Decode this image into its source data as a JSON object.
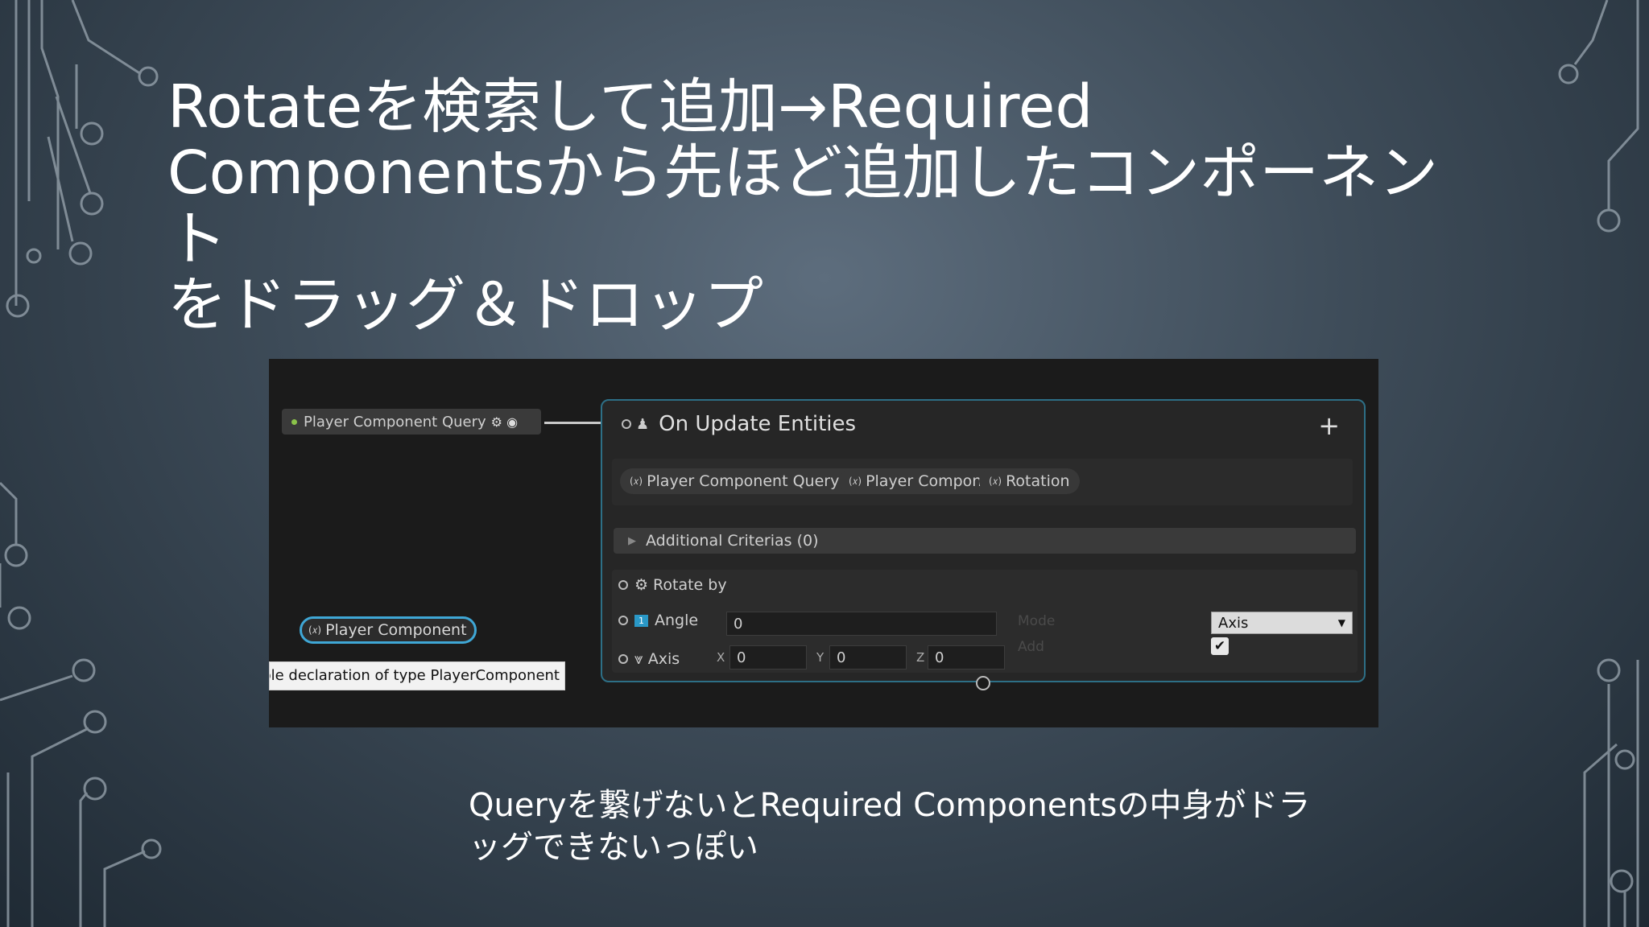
{
  "slide": {
    "title": "Rotateを検索して追加→Required\nComponentsから先ほど追加したコンポーネント\nをドラッグ＆ドロップ",
    "caption": "Queryを繋げないとRequired Componentsの中身がドラッグできないっぽい"
  },
  "editor": {
    "query_node": {
      "label": "Player Component Query"
    },
    "update_node": {
      "title": "On Update Entities",
      "add_icon": "+",
      "fields": [
        {
          "label": "Player Component Query Entity"
        },
        {
          "label": "Player Component"
        },
        {
          "label": "Rotation"
        }
      ],
      "criteria_label": "Additional Criterias (0)",
      "rotate_by_label": "Rotate by",
      "angle": {
        "label": "Angle",
        "value": "0"
      },
      "axis": {
        "label": "Axis",
        "x_label": "X",
        "x_value": "0",
        "y_label": "Y",
        "y_value": "0",
        "z_label": "Z",
        "z_value": "0"
      },
      "mode_label": "Mode",
      "add_label": "Add",
      "mode_select": "Axis",
      "add_checked": "✔"
    },
    "drag_pill": {
      "label": "Player Component"
    },
    "tooltip": "ble declaration of type PlayerComponent"
  }
}
